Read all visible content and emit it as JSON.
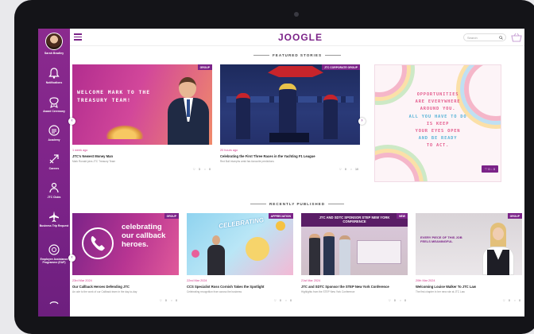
{
  "app": {
    "logo": "JOOGLE"
  },
  "user": {
    "name": "Sarah Bradley"
  },
  "search": {
    "placeholder": "Search"
  },
  "sidebar": {
    "items": [
      {
        "label": "Notifications",
        "icon": "bell-icon"
      },
      {
        "label": "Award Ceremony",
        "icon": "award-icon"
      },
      {
        "label": "Academy",
        "icon": "academy-icon"
      },
      {
        "label": "Careers",
        "icon": "careers-icon"
      },
      {
        "label": "JTC Clubs",
        "icon": "clubs-icon"
      },
      {
        "label": "Business Trip Request",
        "icon": "plane-icon"
      },
      {
        "label": "Employee Assistance Programme (EAP)",
        "icon": "assistance-icon"
      },
      {
        "label": "",
        "icon": "more-icon"
      }
    ]
  },
  "featured": {
    "section_title": "FEATURED STORIES",
    "cards": [
      {
        "badge": "GROUP",
        "image_text": "WELCOME MARK TO THE TREASURY TEAM!",
        "meta": "1 week ago",
        "title": "JTC's Newest Money Man",
        "excerpt": "Mark Ronald joins JTC Treasury Team",
        "likes": "3",
        "comments": "0"
      },
      {
        "badge": "JTC CORPORATE GROUP",
        "image_text": "",
        "meta": "20 hours ago",
        "title": "Celebrating the First Three Races in the Yachting F1 League",
        "excerpt": "Red Bull triumphs amid fan-favourite predictions",
        "likes": "0",
        "comments": "10"
      },
      {
        "badge": "",
        "image_lines": [
          "OPPORTUNITIES",
          "ARE EVERYWHERE",
          "AROUND YOU.",
          "ALL YOU HAVE TO DO",
          "IS KEEP",
          "YOUR EYES OPEN",
          "AND BE READY",
          "TO ACT."
        ],
        "meta": "",
        "title": "",
        "excerpt": "",
        "likes": "0",
        "comments": "0"
      }
    ]
  },
  "recent": {
    "section_title": "RECENTLY PUBLISHED",
    "cards": [
      {
        "badge": "GROUP",
        "image_text": "celebrating our callback heroes.",
        "meta": "23rd Mar 2024",
        "title": "Our Callback Heroes Defending JTC",
        "excerpt": "An ode to the work of our Callback team in the day-to-day",
        "likes": "0",
        "comments": "0"
      },
      {
        "badge": "APPRECIATION",
        "image_text": "CELEBRATING",
        "meta": "22nd Mar 2024",
        "title": "CCS Specialist Ross Cornish Takes the Spotlight",
        "excerpt": "Celebrating recognition from across the business",
        "likes": "0",
        "comments": "0"
      },
      {
        "badge": "NEW",
        "image_text": "JTC AND SDTC SPONSOR STEP NEW YORK CONFERENCE",
        "meta": "21st Mar 2024",
        "title": "JTC and SDTC Sponsor the STEP New York Conference",
        "excerpt": "Highlights from the STEP New York Conference",
        "likes": "0",
        "comments": "0"
      },
      {
        "badge": "GROUP",
        "image_text": "EVERY PIECE OF THIS JOB FEELS MEANINGFUL",
        "meta": "20th Mar 2024",
        "title": "Welcoming Louise Walker To JTC Law",
        "excerpt": "The first chapter in her new role at JTC Law",
        "likes": "0",
        "comments": "0"
      }
    ]
  },
  "colors": {
    "brand": "#7b2388",
    "accent": "#d23a8a"
  }
}
